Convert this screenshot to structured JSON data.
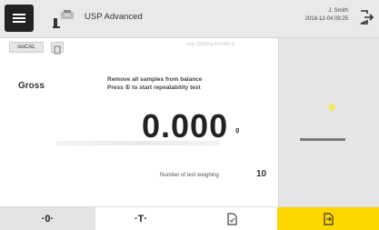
{
  "header": {
    "method": "USP Advanced",
    "user": "J. Smith",
    "datetime": "2018-12-04  09:25"
  },
  "toolbar": {
    "iso_label": "isoCAL",
    "faint_info": "max 22000 g   d=0.001 g"
  },
  "weighing": {
    "mode": "Gross",
    "instruction_line1": "Remove all samples from balance",
    "instruction_line2": "Press ① to start repeatability test",
    "value": "0.000",
    "unit": "g",
    "count_label": "Number of test weighing",
    "count_value": "10"
  },
  "footer": {
    "zero_label": "·0·",
    "tare_label": "·T·"
  },
  "icons": {
    "menu": "hamburger-icon",
    "balance": "balance-icon",
    "logout": "logout-icon",
    "protocol": "document-icon",
    "footer_doc": "document-icon",
    "footer_start": "document-start-icon"
  },
  "colors": {
    "accent": "#ffd700",
    "header_bg": "#e9e9e9"
  }
}
